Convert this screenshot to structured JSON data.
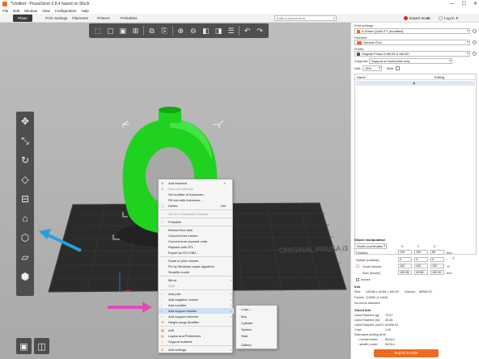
{
  "window": {
    "title": "*Untitled - PrusaSlicer-2.8.4 based on Slic3r",
    "controls": [
      "—",
      "☐",
      "✕"
    ]
  },
  "menu": [
    "File",
    "Edit",
    "Window",
    "View",
    "Configuration",
    "Help"
  ],
  "tabs": [
    "Plater",
    "Print Settings",
    "Filaments",
    "Printers",
    "Printables"
  ],
  "search": {
    "placeholder": "Enter a search term"
  },
  "mode": {
    "label": "Expert mode",
    "color": "#e0261e"
  },
  "login": "Log in",
  "context_menu": {
    "items": [
      {
        "label": "Add instance",
        "shortcut": "+",
        "disabled": false
      },
      {
        "label": "Remove instance",
        "shortcut": "-",
        "disabled": true
      },
      {
        "label": "Set number of instances...",
        "shortcut": "",
        "disabled": false
      },
      {
        "label": "Fill bed with instances...",
        "shortcut": "",
        "disabled": false
      },
      {
        "label": "Delete",
        "shortcut": "Del",
        "disabled": false
      },
      {
        "label": "Set as a Separated Objects",
        "shortcut": "",
        "disabled": true
      },
      {
        "label": "Printable",
        "shortcut": "",
        "disabled": false
      },
      {
        "label": "Reload from disk",
        "shortcut": "",
        "disabled": false
      },
      {
        "label": "Convert from meters",
        "shortcut": "",
        "disabled": false
      },
      {
        "label": "Convert from imperial units",
        "shortcut": "",
        "disabled": false
      },
      {
        "label": "Replace with STL",
        "shortcut": "",
        "disabled": false
      },
      {
        "label": "Export as STL/OBJ...",
        "shortcut": "",
        "disabled": false
      },
      {
        "label": "Scale to print volume",
        "shortcut": "",
        "disabled": false
      },
      {
        "label": "Fix by Windows repair algorithm",
        "shortcut": "",
        "disabled": false
      },
      {
        "label": "Simplify model",
        "shortcut": "",
        "disabled": false
      },
      {
        "label": "Mirror",
        "shortcut": "",
        "disabled": false
      },
      {
        "label": "Split",
        "shortcut": "",
        "disabled": true
      },
      {
        "label": "Add part",
        "shortcut": "",
        "disabled": false
      },
      {
        "label": "Add negative volume",
        "shortcut": "",
        "disabled": false
      },
      {
        "label": "Add modifier",
        "shortcut": "",
        "disabled": false
      },
      {
        "label": "Add support blocker",
        "shortcut": "",
        "disabled": false
      },
      {
        "label": "Add support enforcer",
        "shortcut": "",
        "disabled": false
      },
      {
        "label": "Height range Modifier",
        "shortcut": "",
        "disabled": false
      },
      {
        "label": "Infill",
        "shortcut": "",
        "disabled": false
      },
      {
        "label": "Layers and Perimeters",
        "shortcut": "",
        "disabled": false
      },
      {
        "label": "Support material",
        "shortcut": "",
        "disabled": false
      },
      {
        "label": "Add settings",
        "shortcut": "",
        "disabled": false
      }
    ]
  },
  "submenu": [
    "Load ...",
    "Box",
    "Cylinder",
    "Sphere",
    "Slab",
    "Gallery"
  ],
  "right_panel": {
    "print_settings_label": "Print settings :",
    "print_settings_value": "0.20mm QUALITY (modified)",
    "filament_label": "Filament",
    "filament_value": "Generic PLA",
    "filament_color": "#ed6b21",
    "printer_label": "Printer",
    "printer_value": "Original Prusa i3 MK3S & MK3S+",
    "supports_label": "Supports:",
    "supports_value": "Support on build plate only",
    "infill_label": "Infill:",
    "infill_value": "15%",
    "brim_label": "Brim:",
    "list_name_header": "Name",
    "list_editing_header": "Editing"
  },
  "object_manipulation": {
    "title": "Object manipulation",
    "coord_system": "World coordinates",
    "axes": [
      "X",
      "Y",
      "Z"
    ],
    "position_label": "Position:",
    "position": [
      "125",
      "105",
      "80"
    ],
    "rotation_label": "Rotate (relative):",
    "rotation": [
      "0",
      "0",
      "0"
    ],
    "scale_label": "Scale factors:",
    "scale": [
      "100",
      "100",
      "100"
    ],
    "size_label": "Size [World]:",
    "size": [
      "149.86",
      "49.86",
      "160.00"
    ],
    "inches_label": "Inches",
    "units": [
      "mm",
      "°",
      "%",
      "mm"
    ]
  },
  "info": {
    "title": "Info",
    "size_label": "Size:",
    "size_value": "149.86 x 49.86 x 160.00",
    "volume_label": "Volume:",
    "volume_value": "85960.02",
    "facets_label": "Facets:",
    "facets_value": "114060 (1 shell)",
    "errors": "No errors detected"
  },
  "sliced_info": {
    "title": "Sliced Info",
    "rows": [
      {
        "label": "Used Filament (g):",
        "value": "79.57"
      },
      {
        "label": "Used Filament (m):",
        "value": "26.68"
      },
      {
        "label": "Used Filament (mm³):",
        "value": "64168.16"
      },
      {
        "label": "Cost:",
        "value": "2.02"
      },
      {
        "label": "Estimated printing time:",
        "value": ""
      },
      {
        "label": "- normal mode:",
        "value": "8h44m"
      },
      {
        "label": "- stealth mode:",
        "value": "9h31m"
      }
    ]
  },
  "export_button": "Export G-code",
  "bed_label": "ORIGINAL PRUSA i3 MK3 by Josef Prusa",
  "colors": {
    "model_green": "#1fd21f",
    "arrow_blue": "#2a9fe0",
    "arrow_magenta": "#e04bb7",
    "accent_orange": "#ed6b21"
  }
}
